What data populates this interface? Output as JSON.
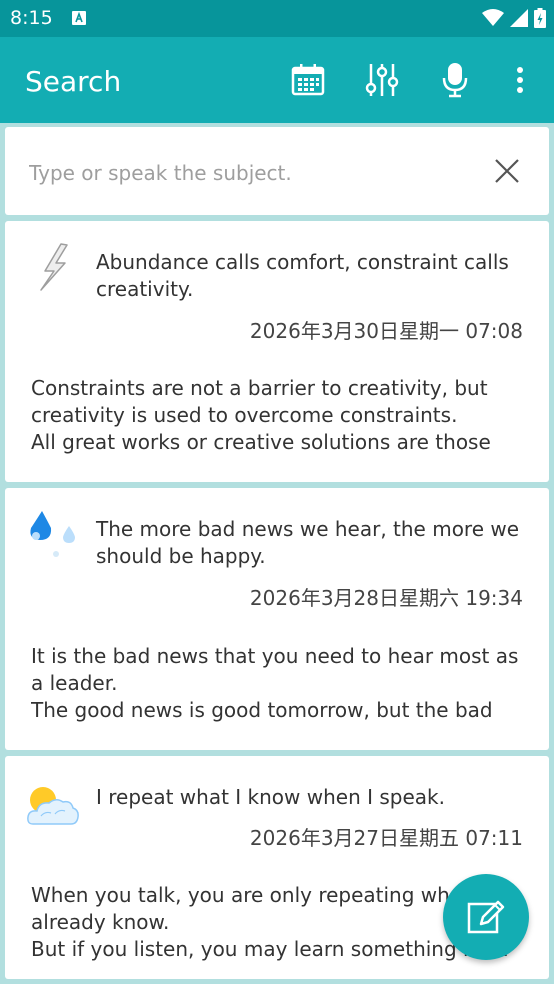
{
  "status": {
    "time": "8:15"
  },
  "appbar": {
    "title": "Search",
    "actions": [
      "calendar-icon",
      "sliders-icon",
      "mic-icon",
      "more-vert-icon"
    ]
  },
  "search": {
    "placeholder": "Type or speak the subject.",
    "value": ""
  },
  "entries": [
    {
      "icon": "lightning-icon",
      "title": "Abundance calls comfort, constraint calls creativity.",
      "date": "2026年3月30日星期一 07:08",
      "body": "Constraints are not a barrier to creativity, but creativity is used to overcome constraints.\nAll great works or creative solutions are those"
    },
    {
      "icon": "rain-icon",
      "title": "The more bad news we hear, the more we should be happy.",
      "date": "2026年3月28日星期六 19:34",
      "body": "It is the bad news that you need to hear most as a leader.\nThe good news is good tomorrow, but the bad"
    },
    {
      "icon": "partly-cloudy-icon",
      "title": "I repeat what I know when I speak.",
      "date": "2026年3月27日星期五 07:11",
      "body": "When you talk, you are only repeating what you already know.\nBut if you listen, you may learn something new."
    }
  ],
  "colors": {
    "statusbar": "#07959b",
    "appbar": "#13adb3",
    "background": "#b2dfdf",
    "fab": "#13adb3"
  }
}
